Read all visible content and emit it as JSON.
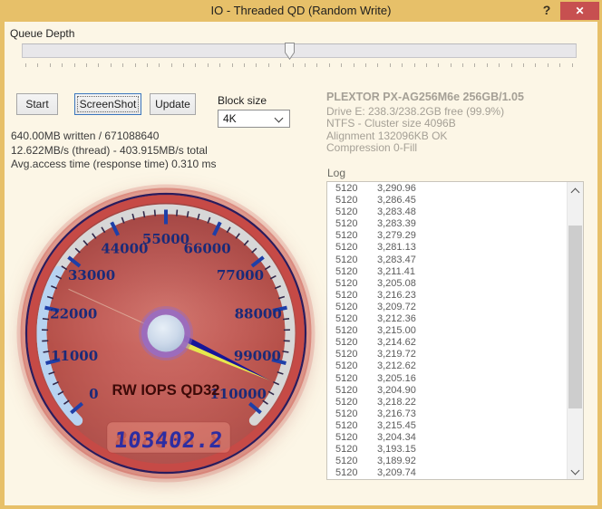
{
  "window": {
    "title": "IO - Threaded QD (Random Write)",
    "help_glyph": "?",
    "close_glyph": "✕"
  },
  "queue_depth": {
    "label": "Queue Depth",
    "fraction": 0.482,
    "tick_count": 46
  },
  "toolbar": {
    "start_label": "Start",
    "screenshot_label": "ScreenShot",
    "update_label": "Update"
  },
  "block_size": {
    "label": "Block size",
    "selected": "4K"
  },
  "status": {
    "line1": "640.00MB written / 671088640",
    "line2": "12.622MB/s (thread) - 403.915MB/s total",
    "line3": "Avg.access time (response time) 0.310 ms"
  },
  "drive_info": {
    "title": "PLEXTOR PX-AG256M6e 256GB/1.05",
    "lines": [
      "Drive E: 238.3/238.2GB free (99.9%)",
      "NTFS - Cluster size 4096B",
      "Alignment 132096KB OK",
      "Compression 0-Fill"
    ]
  },
  "log": {
    "label": "Log",
    "rows": [
      [
        "5120",
        "3,290.96"
      ],
      [
        "5120",
        "3,286.45"
      ],
      [
        "5120",
        "3,283.48"
      ],
      [
        "5120",
        "3,283.39"
      ],
      [
        "5120",
        "3,279.29"
      ],
      [
        "5120",
        "3,281.13"
      ],
      [
        "5120",
        "3,283.47"
      ],
      [
        "5120",
        "3,211.41"
      ],
      [
        "5120",
        "3,205.08"
      ],
      [
        "5120",
        "3,216.23"
      ],
      [
        "5120",
        "3,209.72"
      ],
      [
        "5120",
        "3,212.36"
      ],
      [
        "5120",
        "3,215.00"
      ],
      [
        "5120",
        "3,214.62"
      ],
      [
        "5120",
        "3,219.72"
      ],
      [
        "5120",
        "3,212.62"
      ],
      [
        "5120",
        "3,205.16"
      ],
      [
        "5120",
        "3,204.90"
      ],
      [
        "5120",
        "3,218.22"
      ],
      [
        "5120",
        "3,216.73"
      ],
      [
        "5120",
        "3,215.45"
      ],
      [
        "5120",
        "3,204.34"
      ],
      [
        "5120",
        "3,193.15"
      ],
      [
        "5120",
        "3,189.92"
      ],
      [
        "5120",
        "3,209.74"
      ]
    ]
  },
  "chart_data": {
    "type": "gauge",
    "title": "RW IOPS QD32",
    "value": 103402.2,
    "display_value": "103402.2",
    "lcd_ghost": "888888.8",
    "min": 0,
    "max": 110000,
    "major_step": 11000,
    "minor_divisions": 5,
    "start_angle": 220,
    "end_angle": -40,
    "tick_labels": [
      "0",
      "11000",
      "22000",
      "33000",
      "44000",
      "55000",
      "66000",
      "77000",
      "88000",
      "99000",
      "110000"
    ],
    "blue_arc_end_value": 29700,
    "colors": {
      "face": "#c5605a",
      "band": "#d7d7d7",
      "band_blue": "#b7d3f1",
      "major_tick": "#1e3fa8",
      "minor_tick": "#32284a",
      "label": "#1b2a78",
      "needle_dark": "#16169a",
      "needle_light": "#e6e84e",
      "hub_ring": "#9a6cc0",
      "lcd_digits": "#2d2da2",
      "title_text": "#3c0a08",
      "titlebar": "#e7c069",
      "close_button": "#c75050"
    }
  }
}
